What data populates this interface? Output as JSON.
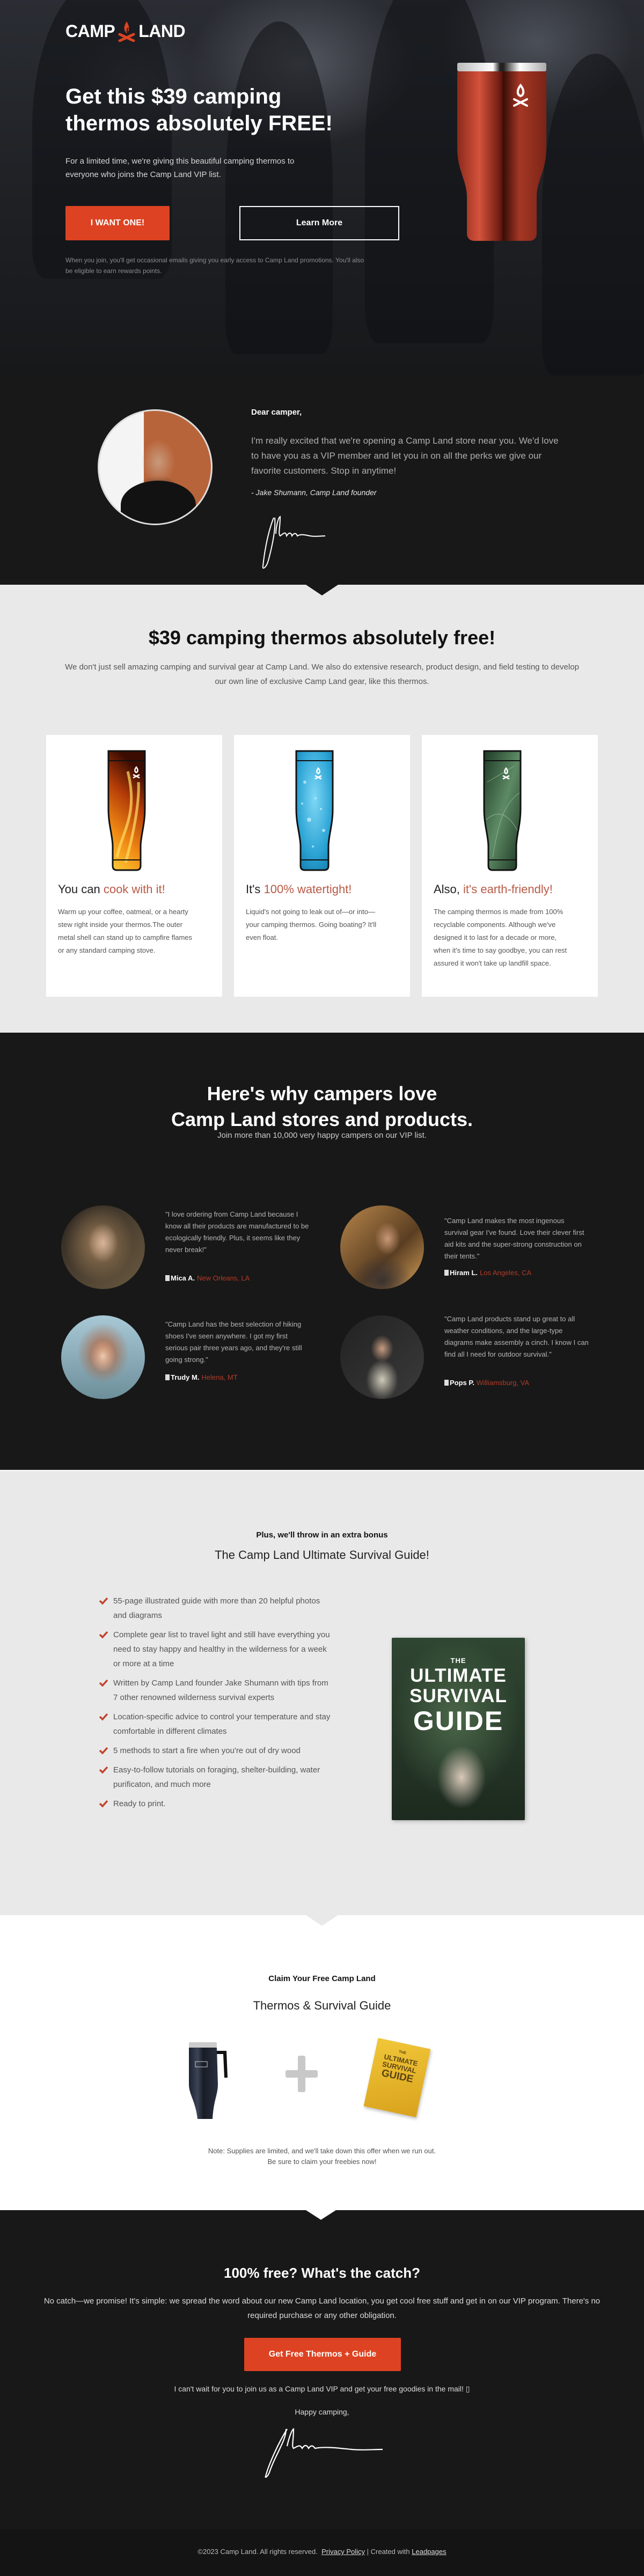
{
  "brand": {
    "name_left": "CAMP",
    "name_right": "LAND",
    "accent": "#dd4322",
    "logo_icon": "campfire-icon"
  },
  "hero": {
    "title": "Get this $39 camping thermos absolutely FREE!",
    "subtitle": "For a limited time, we're giving this beautiful camping thermos to everyone who joins the Camp Land VIP list.",
    "primary_button": "I WANT ONE!",
    "secondary_button": "Learn More",
    "fine_print": "When you join, you'll get occasional emails giving you early access to Camp Land promotions. You'll also be eligible to earn rewards points."
  },
  "letter": {
    "greeting": "Dear camper,",
    "body": "I'm really excited that we're opening a Camp Land store near you. We'd love to have you as a VIP member and let you in on all the perks we give our favorite customers. Stop in anytime!",
    "signoff": "- Jake Shumann, Camp Land founder"
  },
  "features": {
    "title": "$39 camping thermos absolutely free!",
    "intro": "We don't just sell amazing camping and survival gear at Camp Land. We also do extensive research, product design, and field testing to develop our own line of exclusive Camp Land gear, like this thermos.",
    "cards": [
      {
        "lead": "You can ",
        "highlight": "cook with it!",
        "body": "Warm up your coffee, oatmeal, or a hearty stew right inside your thermos.The outer metal shell can stand up to campfire flames or any standard camping stove.",
        "image": "fire-pattern-thermos"
      },
      {
        "lead": "It's ",
        "highlight": "100% watertight!",
        "body": "Liquid's not going to leak out of—or into—your camping thermos. Going boating? It'll even float.",
        "image": "water-pattern-thermos"
      },
      {
        "lead": "Also, ",
        "highlight": "it's earth-friendly!",
        "body": "The camping thermos is made from 100% recyclable components. Although we've designed it to last for a decade or more, when it's time to say goodbye, you can rest assured it won't take up landfill space.",
        "image": "leaf-pattern-thermos"
      }
    ]
  },
  "testimonials": {
    "title_line1": "Here's why campers love",
    "title_line2": "Camp Land stores and products.",
    "subtitle": "Join more than 10,000 very happy campers on our VIP list.",
    "items": [
      {
        "quote": "\"I love ordering from Camp Land because I know all their products are manufactured to be ecologically friendly. Plus, it seems like they never break!\"",
        "name": "Mica A.",
        "location": "New Orleans, LA"
      },
      {
        "quote": "\"Camp Land makes the most ingenous survival gear I've found. Love their clever first aid kits and the super-strong construction on their tents.\"",
        "name": "Hiram L.",
        "location": "Los Angeles, CA"
      },
      {
        "quote": "\"Camp Land has the best selection of hiking shoes I've seen anywhere. I got my first serious pair three years ago, and they're still going strong.\"",
        "name": "Trudy M.",
        "location": "Helena, MT"
      },
      {
        "quote": "\"Camp Land products stand up great to all weather conditions, and the large-type diagrams make assembly a cinch. I know I can find all I need for outdoor survival.\"",
        "name": "Pops P.",
        "location": "Williamsburg, VA"
      }
    ]
  },
  "bonus": {
    "kicker": "Plus, we'll throw in an extra bonus",
    "title": "The Camp Land Ultimate Survival Guide!",
    "items": [
      "55-page illustrated guide with more than 20 helpful photos and diagrams",
      "Complete gear list to travel light and still have everything you need to stay happy and healthy in the wilderness for a week or more at a time",
      "Written by Camp Land founder Jake Shumann with tips from 7 other renowned wilderness survival experts",
      "Location-specific advice to control your temperature and stay comfortable in different climates",
      "5 methods to start a fire when you're out of dry wood",
      "Easy-to-follow tutorials on foraging, shelter-building, water purificaton, and much more",
      "Ready to print."
    ],
    "book": {
      "line1": "THE",
      "line2": "ULTIMATE SURVIVAL",
      "line3": "GUIDE"
    }
  },
  "claim": {
    "kicker": "Claim Your Free Camp Land",
    "title": "Thermos & Survival Guide",
    "book_label": {
      "line1": "THE",
      "line2": "ULTIMATE",
      "line3": "SURVIVAL",
      "line4": "GUIDE"
    },
    "note_line1": "Note: Supplies are limited, and we'll take down this offer when we run out.",
    "note_line2": "Be sure to claim your freebies now!"
  },
  "catch": {
    "title": "100% free? What's the catch?",
    "body": "No catch—we promise! It's simple: we spread the word about our new Camp Land location, you get cool free stuff and get in on our VIP program. There's no required purchase or any other obligation.",
    "cta": "Get Free Thermos + Guide",
    "wait": "I can't wait for you to join us as a Camp Land VIP and get your free goodies in the mail! ▯",
    "happy": "Happy camping,"
  },
  "footer": {
    "copyright": "©2023 Camp Land. All rights reserved.",
    "privacy": "Privacy Policy",
    "separator": "|",
    "created_with": "Created with",
    "leadpages": "Leadpages"
  }
}
